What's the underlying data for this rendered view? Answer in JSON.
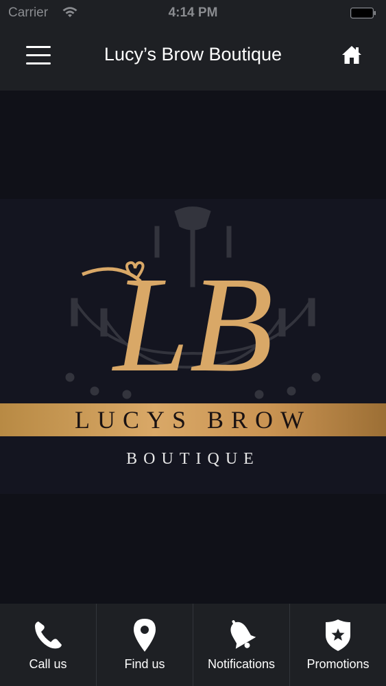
{
  "status_bar": {
    "carrier": "Carrier",
    "time": "4:14 PM"
  },
  "nav_bar": {
    "title": "Lucy’s Brow Boutique"
  },
  "logo": {
    "monogram": "LB",
    "line1": "LUCYS BROW",
    "line2": "BOUTIQUE",
    "gold_color": "#d9a867"
  },
  "tab_bar": {
    "tabs": [
      {
        "label": "Call us",
        "icon": "phone-icon"
      },
      {
        "label": "Find us",
        "icon": "location-pin-icon"
      },
      {
        "label": "Notifications",
        "icon": "bell-icon"
      },
      {
        "label": "Promotions",
        "icon": "star-badge-icon"
      }
    ]
  }
}
